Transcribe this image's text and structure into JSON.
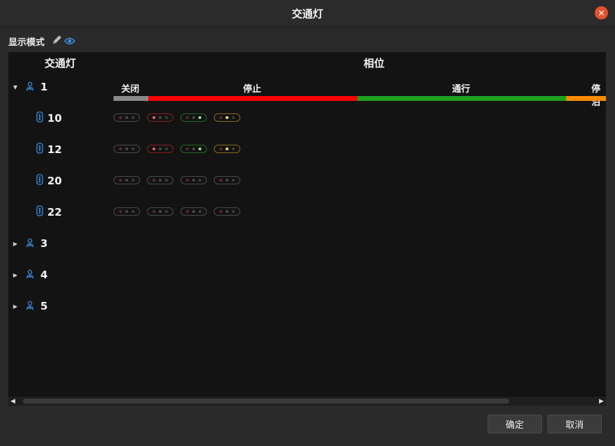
{
  "window": {
    "title": "交通灯",
    "close_icon": "close-icon"
  },
  "display_mode": {
    "label": "显示模式",
    "icons": [
      "edit-icon",
      "eye-icon"
    ]
  },
  "table": {
    "header_light": "交通灯",
    "header_phase": "相位"
  },
  "phases": [
    {
      "label": "关闭",
      "color": "#8a8a8a"
    },
    {
      "label": "停止",
      "color": "#ff0000"
    },
    {
      "label": "通行",
      "color": "#1fa01f"
    },
    {
      "label": "停泊",
      "color": "#ff8c00"
    }
  ],
  "tree": [
    {
      "label": "1",
      "expanded": true,
      "icon": "group-icon",
      "children": [
        {
          "label": "10",
          "icon": "traffic-light-icon",
          "lamps": [
            "off-red",
            "red",
            "green",
            "yellow"
          ]
        },
        {
          "label": "12",
          "icon": "traffic-light-icon",
          "lamps": [
            "off-red",
            "red",
            "green",
            "yellow"
          ]
        },
        {
          "label": "20",
          "icon": "traffic-light-icon",
          "lamps": [
            "off",
            "off",
            "off",
            "off"
          ]
        },
        {
          "label": "22",
          "icon": "traffic-light-icon",
          "lamps": [
            "off",
            "off",
            "off",
            "off"
          ]
        }
      ]
    },
    {
      "label": "3",
      "expanded": false,
      "icon": "group-icon",
      "children": []
    },
    {
      "label": "4",
      "expanded": false,
      "icon": "group-icon",
      "children": []
    },
    {
      "label": "5",
      "expanded": false,
      "icon": "group-icon",
      "children": []
    }
  ],
  "buttons": {
    "ok": "确定",
    "cancel": "取消"
  },
  "colors": {
    "accent_blue": "#3a8ee6",
    "lamp_red": "#ff5b5b",
    "lamp_green": "#8df08d",
    "lamp_yellow": "#f5e36a"
  }
}
